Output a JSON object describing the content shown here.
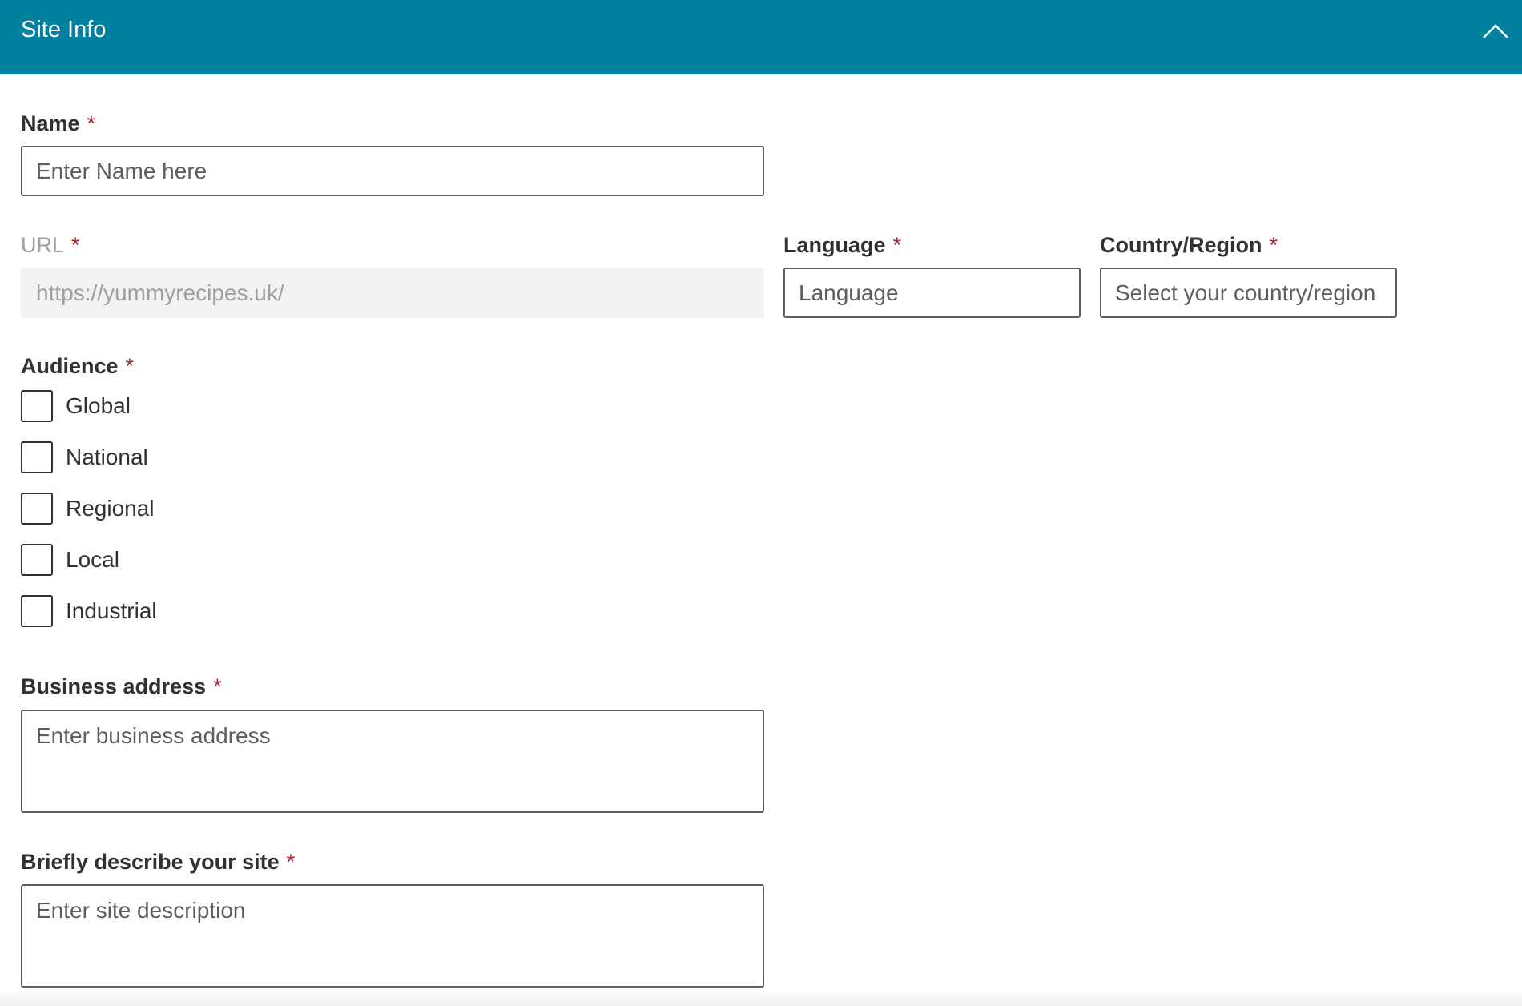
{
  "header": {
    "title": "Site Info",
    "collapse_icon": "chevron-up-icon",
    "color": "#0180a0"
  },
  "required_marker": "*",
  "name": {
    "label": "Name",
    "placeholder": "Enter Name here",
    "value": ""
  },
  "url": {
    "label": "URL",
    "placeholder": "https://yummyrecipes.uk/",
    "disabled": true
  },
  "language": {
    "label": "Language",
    "placeholder": "Language"
  },
  "country": {
    "label": "Country/Region",
    "placeholder": "Select your country/region"
  },
  "audience": {
    "label": "Audience",
    "options": [
      {
        "label": "Global",
        "checked": false
      },
      {
        "label": "National",
        "checked": false
      },
      {
        "label": "Regional",
        "checked": false
      },
      {
        "label": "Local",
        "checked": false
      },
      {
        "label": "Industrial",
        "checked": false
      }
    ]
  },
  "business_address": {
    "label": "Business address",
    "placeholder": "Enter business address"
  },
  "description": {
    "label": "Briefly describe your site",
    "placeholder": "Enter site description"
  },
  "colors": {
    "required": "#a4262c",
    "text": "#323130",
    "disabled_bg": "#f3f2f1"
  }
}
